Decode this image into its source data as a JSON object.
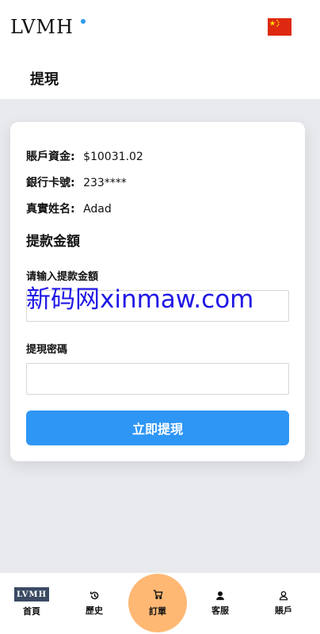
{
  "header": {
    "brand": "LVMH",
    "language_flag": "china-flag-icon",
    "page_title": "提現"
  },
  "account": {
    "balance_label": "賬戶資金:",
    "balance_value": "$10031.02",
    "card_label": "銀行卡號:",
    "card_value": "233****",
    "name_label": "真實姓名:",
    "name_value": "Adad"
  },
  "withdraw": {
    "section_title": "提款金額",
    "amount_label": "请输入提款金額",
    "amount_value": "",
    "password_label": "提現密碼",
    "password_value": "",
    "submit_label": "立即提現"
  },
  "watermark": "新码网xinmaw.com",
  "bottom_nav": {
    "home": "首頁",
    "home_thumb": "LVMH",
    "history": "歷史",
    "orders": "訂單",
    "service": "客服",
    "account": "賬戶"
  },
  "colors": {
    "primary": "#2e96f5",
    "order_highlight": "#ffb874",
    "watermark": "#1f17e6",
    "flag": "#de2910"
  }
}
